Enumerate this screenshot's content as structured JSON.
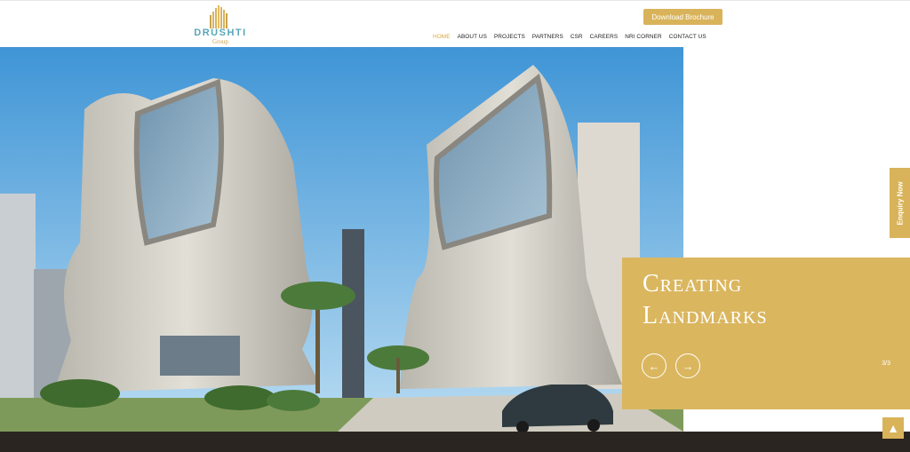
{
  "header": {
    "logo_text": "DRUSHTI",
    "logo_sub": "Group",
    "brochure_label": "Download Brochure"
  },
  "nav": {
    "items": [
      "HOME",
      "ABOUT US",
      "PROJECTS",
      "PARTNERS",
      "CSR",
      "CAREERS",
      "NRI CORNER",
      "CONTACT US"
    ],
    "active": "HOME"
  },
  "hero": {
    "caption_line1": "Creating",
    "caption_line2": "Landmarks",
    "counter": "3/3",
    "prev_icon": "arrow-left-icon",
    "next_icon": "arrow-right-icon"
  },
  "enquiry_label": "Enquiry Now",
  "scroll_top_icon": "chevron-up-icon",
  "colors": {
    "accent": "#dab65f",
    "footer": "#2b2522",
    "sky": "#5fa9df"
  }
}
